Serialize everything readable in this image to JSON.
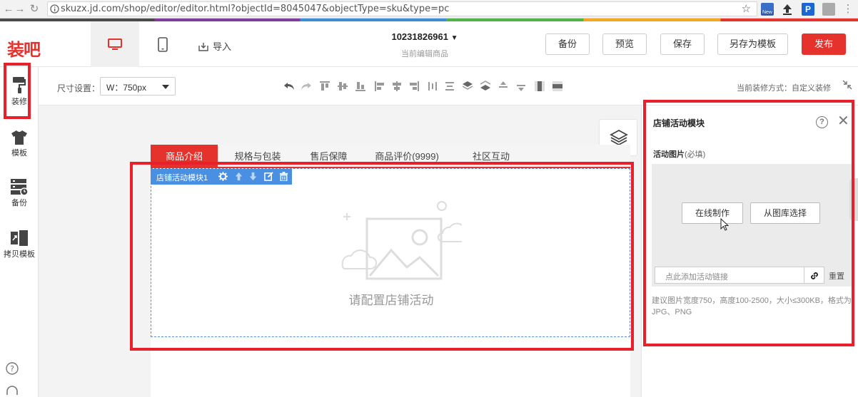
{
  "browser": {
    "url": "skuzx.jd.com/shop/editor/editor.html?objectId=8045047&objectType=sku&type=pc",
    "ext_new_label": "New"
  },
  "header": {
    "logo": "装吧",
    "import_label": "导入",
    "sku": "10231826961",
    "sku_sub": "当前编辑商品",
    "buttons": {
      "backup": "备份",
      "preview": "预览",
      "save": "保存",
      "save_template": "另存为模板",
      "publish": "发布"
    },
    "publish_color": "#e6322d"
  },
  "sidebar": {
    "items": [
      {
        "label": "装修",
        "icon": "paint-roller-icon"
      },
      {
        "label": "模板",
        "icon": "shirt-icon"
      },
      {
        "label": "备份",
        "icon": "server-backup-icon"
      },
      {
        "label": "拷贝模板",
        "icon": "copy-template-icon"
      }
    ]
  },
  "toolbar": {
    "size_label": "尺寸设置：",
    "size_value": "W：750px",
    "mode_label": "当前装修方式：自定义装修"
  },
  "canvas": {
    "tabs": [
      "商品介绍",
      "规格与包装",
      "售后保障",
      "商品评价(9999)",
      "社区互动"
    ],
    "module_title": "店铺活动模块1",
    "placeholder": "请配置店铺活动"
  },
  "panel": {
    "title": "店铺活动模块",
    "image_label": "活动图片",
    "image_required": "(必填)",
    "btn_online": "在线制作",
    "btn_library": "从图库选择",
    "link_placeholder": "点此添加活动链接",
    "reset": "重置",
    "hint": "建议图片宽度750，高度100-2500，大小≤300KB，格式为JPG、PNG"
  }
}
